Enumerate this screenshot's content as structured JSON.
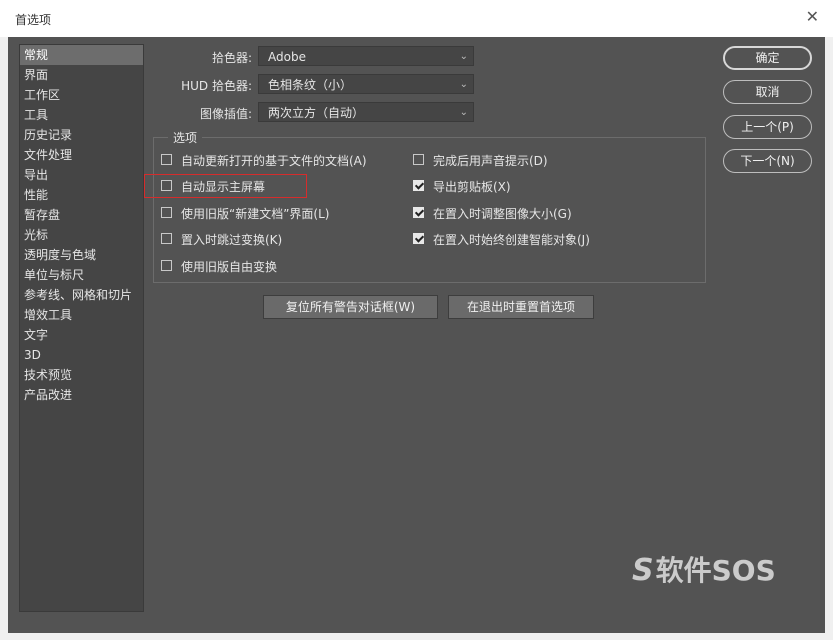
{
  "window": {
    "title": "首选项",
    "close_symbol": "✕"
  },
  "sidebar": {
    "items": [
      "常规",
      "界面",
      "工作区",
      "工具",
      "历史记录",
      "文件处理",
      "导出",
      "性能",
      "暂存盘",
      "光标",
      "透明度与色域",
      "单位与标尺",
      "参考线、网格和切片",
      "增效工具",
      "文字",
      "3D",
      "技术预览",
      "产品改进"
    ],
    "active_index": 0
  },
  "fields": {
    "color_picker": {
      "label": "拾色器:",
      "value": "Adobe"
    },
    "hud_picker": {
      "label": "HUD 拾色器:",
      "value": "色相条纹（小）"
    },
    "interpolation": {
      "label": "图像插值:",
      "value": "两次立方（自动）"
    }
  },
  "options": {
    "legend": "选项",
    "left": [
      {
        "label": "自动更新打开的基于文件的文档(A)",
        "checked": false
      },
      {
        "label": "自动显示主屏幕",
        "checked": false
      },
      {
        "label": "使用旧版“新建文档”界面(L)",
        "checked": false
      },
      {
        "label": "置入时跳过变换(K)",
        "checked": false
      },
      {
        "label": "使用旧版自由变换",
        "checked": false
      }
    ],
    "right": [
      {
        "label": "完成后用声音提示(D)",
        "checked": false
      },
      {
        "label": "导出剪贴板(X)",
        "checked": true
      },
      {
        "label": "在置入时调整图像大小(G)",
        "checked": true
      },
      {
        "label": "在置入时始终创建智能对象(J)",
        "checked": true
      }
    ]
  },
  "buttons": {
    "reset_warnings": "复位所有警告对话框(W)",
    "reset_on_quit": "在退出时重置首选项",
    "ok": "确定",
    "cancel": "取消",
    "prev": "上一个(P)",
    "next": "下一个(N)"
  },
  "watermark": {
    "logo": "S",
    "text": "软件SOS"
  },
  "colors": {
    "panel": "#535353",
    "sidebar": "#454545",
    "highlight": "#d62c2c"
  }
}
